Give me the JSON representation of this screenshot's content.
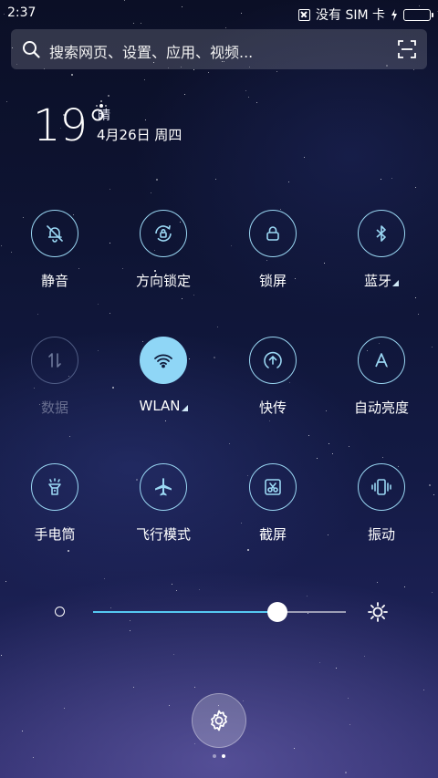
{
  "status_bar": {
    "time": "2:37",
    "sim_text": "没有 SIM 卡",
    "battery_color": "#5bd45b"
  },
  "search": {
    "placeholder": "搜索网页、设置、应用、视频..."
  },
  "weather": {
    "temperature": "19°",
    "condition": "晴",
    "date": "4月26日 周四"
  },
  "toggles": [
    {
      "label": "静音",
      "icon": "bell-off-icon",
      "state": "off"
    },
    {
      "label": "方向锁定",
      "icon": "rotation-lock-icon",
      "state": "off"
    },
    {
      "label": "锁屏",
      "icon": "lock-icon",
      "state": "off"
    },
    {
      "label": "蓝牙",
      "icon": "bluetooth-icon",
      "state": "off",
      "has_menu": true
    },
    {
      "label": "数据",
      "icon": "mobile-data-icon",
      "state": "disabled"
    },
    {
      "label": "WLAN",
      "icon": "wifi-icon",
      "state": "on",
      "has_menu": true
    },
    {
      "label": "快传",
      "icon": "quick-transfer-icon",
      "state": "off"
    },
    {
      "label": "自动亮度",
      "icon": "auto-brightness-icon",
      "state": "off"
    },
    {
      "label": "手电筒",
      "icon": "flashlight-icon",
      "state": "off"
    },
    {
      "label": "飞行模式",
      "icon": "airplane-icon",
      "state": "off"
    },
    {
      "label": "截屏",
      "icon": "screenshot-icon",
      "state": "off"
    },
    {
      "label": "振动",
      "icon": "vibrate-icon",
      "state": "off"
    }
  ],
  "brightness": {
    "level_fraction": 0.73,
    "accent_color": "#55c8f2"
  },
  "pager": {
    "pages": 2,
    "current": 2
  },
  "colors": {
    "accent": "#8fd6f6"
  }
}
